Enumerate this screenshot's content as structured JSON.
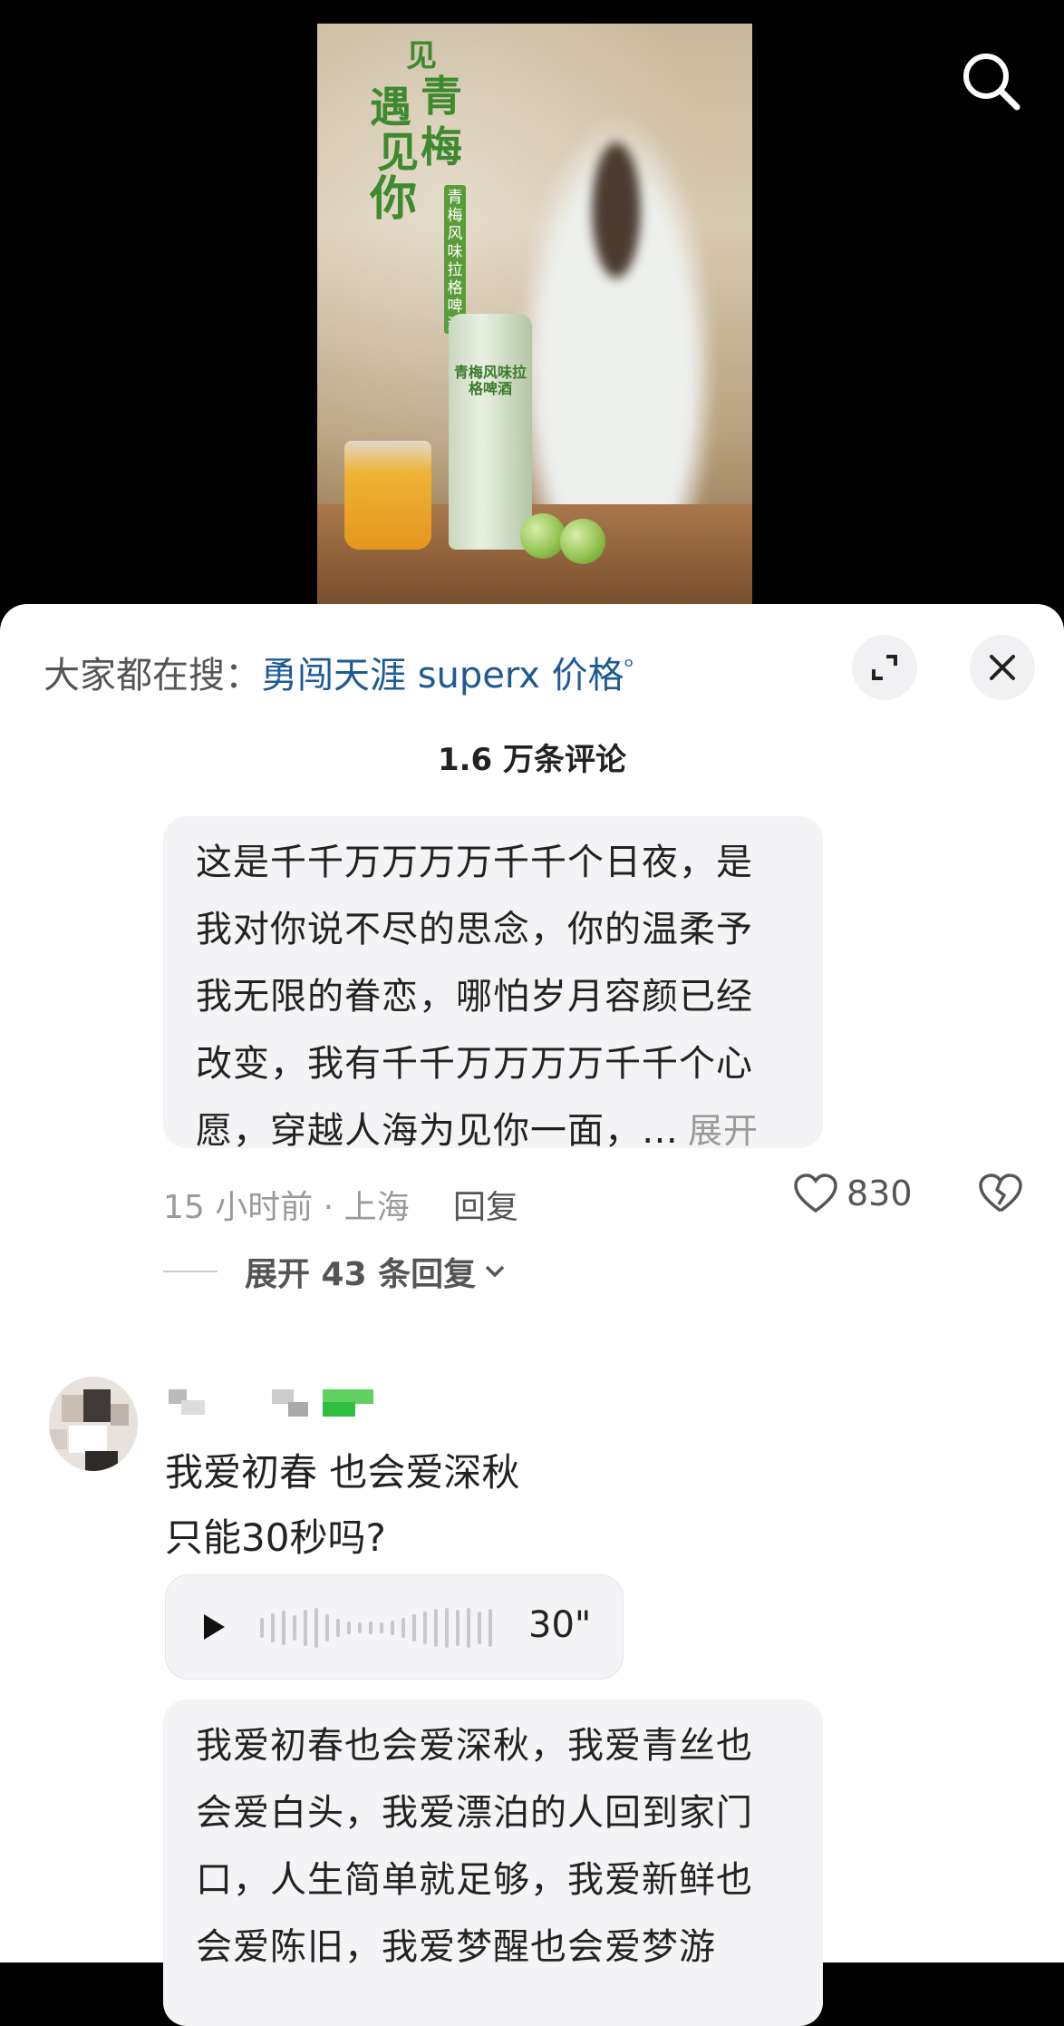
{
  "video": {
    "poster_title_chars": [
      "见",
      "青",
      "遇",
      "梅",
      "见",
      "你"
    ],
    "poster_tag": "青梅风味拉格啤酒",
    "can_label": "青梅风味拉格啤酒",
    "search_icon": "search-icon"
  },
  "sheet": {
    "hot_search_prefix": "大家都在搜：",
    "hot_search_keyword": "勇闯天涯 superx 价格",
    "hot_search_icon": "ᵒ",
    "fullscreen_icon": "expand-icon",
    "close_icon": "close-icon",
    "comment_count": "1.6 万条评论"
  },
  "comment1": {
    "lines": [
      "这是千千万万万万千千个日夜，是",
      "我对你说不尽的思念，你的温柔予",
      "我无限的眷恋，哪怕岁月容颜已经",
      "改变，我有千千万万万万千千个心",
      "愿，穿越人海为见你一面，…"
    ],
    "expand_label": "展开",
    "meta": "15 小时前 · 上海",
    "reply_label": "回复",
    "likes": "830",
    "replies_toggle": "展开 43 条回复"
  },
  "comment2": {
    "line1": "我爱初春 也会爱深秋",
    "line2": "只能30秒吗?",
    "voice_duration": "30\"",
    "transcript": [
      "我爱初春也会爱深秋，我爱青丝也",
      "会爱白头，我爱漂泊的人回到家门",
      "口，人生简单就足够，我爱新鲜也",
      "会爱陈旧，我爱梦醒也会爱梦游"
    ]
  },
  "colors": {
    "link": "#1f5a94",
    "bubble": "#f4f4f6",
    "muted": "#9a9a9a"
  }
}
